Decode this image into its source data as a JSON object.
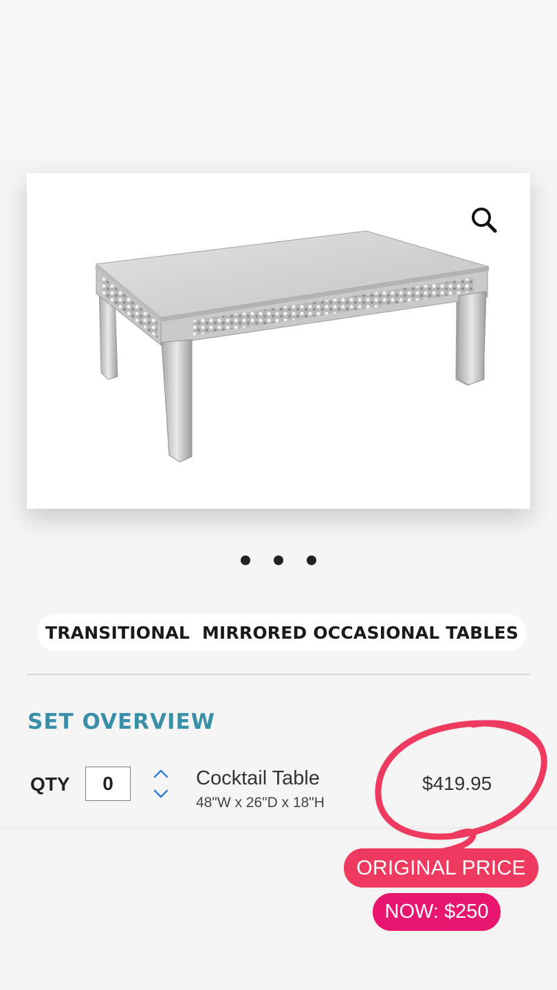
{
  "product": {
    "title": "TRANSITIONAL  MIRRORED OCCASIONAL TABLES",
    "image_icon": "mirrored-coffee-table",
    "zoom_icon": "magnifier-icon"
  },
  "carousel": {
    "dots": 3
  },
  "set_overview": {
    "heading": "SET OVERVIEW",
    "items": [
      {
        "qty_label": "QTY",
        "qty_value": "0",
        "name": "Cocktail Table",
        "dimensions": "48\"W x 26\"D x 18\"H",
        "price": "$419.95"
      }
    ]
  },
  "annotations": {
    "original_price_label": "ORIGINAL PRICE",
    "now_price_label": "NOW: $250"
  },
  "colors": {
    "heading_accent": "#3a8fa8",
    "stepper_blue": "#2a7fd6",
    "circle_annotation": "#ee3a5e",
    "original_badge": "#ee3a5e",
    "now_badge": "#e8166e"
  }
}
